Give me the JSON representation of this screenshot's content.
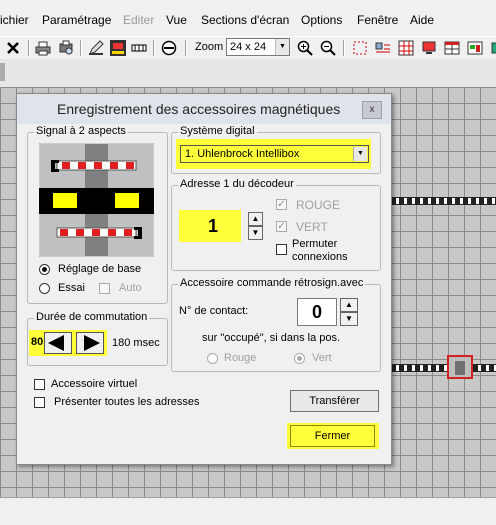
{
  "menu": {
    "items": [
      "ichier",
      "Paramétrage",
      "Editer",
      "Vue",
      "Sections d'écran",
      "Options",
      "Fenêtre",
      "Aide"
    ]
  },
  "toolbar": {
    "zoom_label": "Zoom",
    "zoom_value": "24 x 24"
  },
  "dialog": {
    "title": "Enregistrement des accessoires magnétiques",
    "close_label": "x",
    "signal_group": {
      "legend": "Signal à 2 aspects",
      "radio_base": "Réglage de base",
      "radio_test": "Essai",
      "auto_label": "Auto"
    },
    "duration_group": {
      "legend": "Durée de commutation",
      "value_prefix": "80",
      "value_text": "180 msec"
    },
    "digital_group": {
      "legend": "Système digital",
      "selected": "1. Uhlenbrock Intellibox"
    },
    "address_group": {
      "legend": "Adresse 1 du décodeur",
      "value": "1",
      "rouge_label": "ROUGE",
      "vert_label": "VERT",
      "permuter_line1": "Permuter",
      "permuter_line2": "connexions"
    },
    "feedback_group": {
      "legend": "Accessoire commande rétrosign.avec",
      "contact_label": "N° de contact:",
      "contact_value": "0",
      "occupied_text": "sur \"occupé\", si dans la pos.",
      "rouge_label": "Rouge",
      "vert_label": "Vert"
    },
    "virtual_label": "Accessoire virtuel",
    "all_addresses_label": "Présenter toutes les adresses",
    "transfer_button": "Transférer",
    "close_button": "Fermer"
  },
  "colors": {
    "highlight": "#ffff3a",
    "selection": "#d02020"
  }
}
